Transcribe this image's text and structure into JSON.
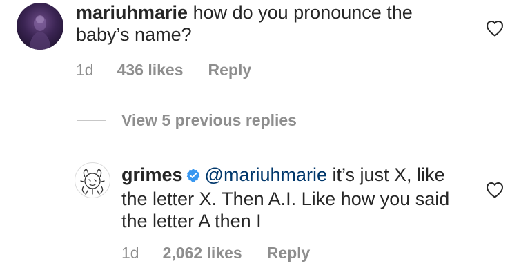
{
  "comments": [
    {
      "username": "mariuhmarie",
      "text": " how do you pronounce the baby’s name?",
      "time": "1d",
      "likes": "436 likes",
      "reply_label": "Reply"
    }
  ],
  "view_replies": {
    "label": "View 5 previous replies"
  },
  "replies": [
    {
      "username": "grimes",
      "verified": true,
      "mention": "@mariuhmarie",
      "text": " it’s just X, like the letter X.  Then A.I. Like how you said the letter A then I",
      "time": "1d",
      "likes": "2,062 likes",
      "reply_label": "Reply"
    }
  ],
  "colors": {
    "text": "#262626",
    "secondary": "#8e8e8e",
    "mention": "#00376b",
    "verified_badge": "#3897f0"
  },
  "icons": {
    "like": "heart-outline-icon",
    "verified": "verified-badge-icon"
  }
}
